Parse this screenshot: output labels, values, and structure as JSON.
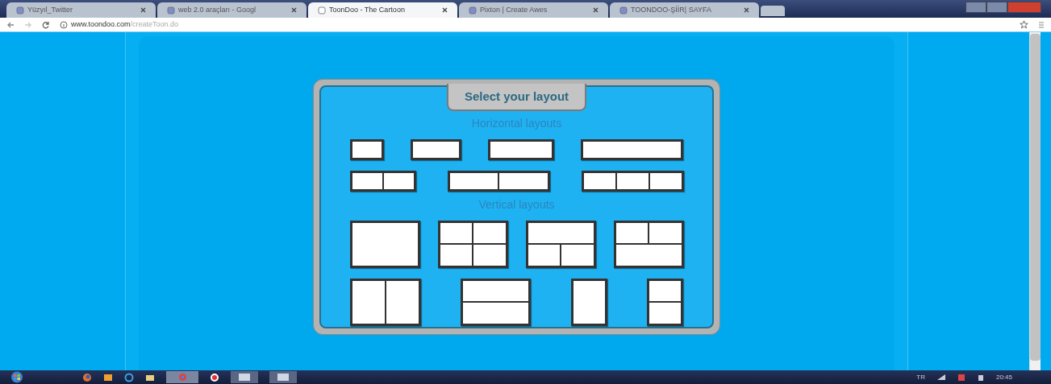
{
  "browser": {
    "tabs": [
      {
        "title": "Yüzyıl_Twitter",
        "selected": false
      },
      {
        "title": "web 2.0 araçları - Googl",
        "selected": false
      },
      {
        "title": "ToonDoo - The Cartoon",
        "selected": true
      },
      {
        "title": "Pixton | Create Awes",
        "selected": false
      },
      {
        "title": "TOONDOO-ŞİİR| SAYFA",
        "selected": false
      }
    ],
    "url_host": "www.toondoo.com",
    "url_path": "/createToon.do"
  },
  "dialog": {
    "title": "Select your layout",
    "sections": [
      {
        "heading": "Horizontal layouts",
        "rows": [
          [
            {
              "kind": "h-small"
            },
            {
              "kind": "h-medium"
            },
            {
              "kind": "h-large"
            },
            {
              "kind": "h-wide"
            }
          ],
          [
            {
              "kind": "h-two"
            },
            {
              "kind": "h-two-wide"
            },
            {
              "kind": "h-three"
            }
          ]
        ]
      },
      {
        "heading": "Vertical layouts",
        "rows": [
          [
            {
              "kind": "v-single"
            },
            {
              "kind": "v-grid"
            },
            {
              "kind": "v-top-one-bottom-two"
            },
            {
              "kind": "v-top-two-bottom-one"
            }
          ],
          [
            {
              "kind": "v-two-columns"
            },
            {
              "kind": "v-two-rows"
            },
            {
              "kind": "v-narrow"
            },
            {
              "kind": "v-narrow-two-rows"
            }
          ]
        ]
      }
    ]
  },
  "taskbar": {
    "language": "TR",
    "clock": "20:45"
  }
}
